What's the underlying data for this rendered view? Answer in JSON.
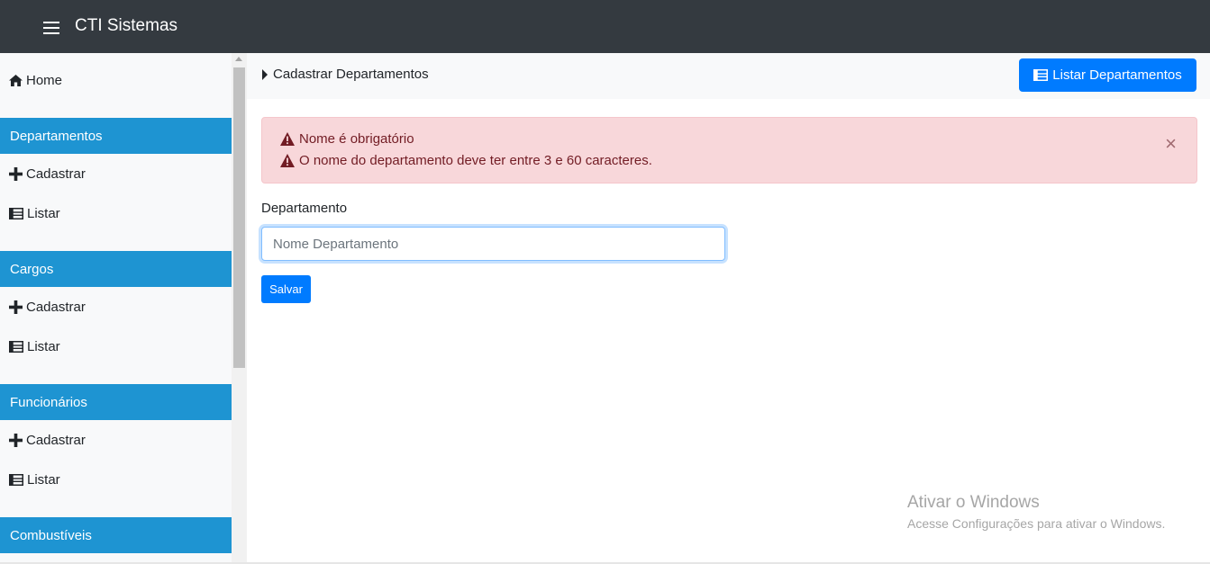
{
  "navbar": {
    "brand": "CTI Sistemas"
  },
  "sidebar": {
    "home_label": "Home",
    "sections": [
      {
        "title": "Departamentos",
        "items": [
          "Cadastrar",
          "Listar"
        ]
      },
      {
        "title": "Cargos",
        "items": [
          "Cadastrar",
          "Listar"
        ]
      },
      {
        "title": "Funcionários",
        "items": [
          "Cadastrar",
          "Listar"
        ]
      },
      {
        "title": "Combustíveis"
      }
    ],
    "header_color": "#1e94d2"
  },
  "header": {
    "breadcrumb": "Cadastrar Departamentos",
    "list_button": "Listar Departamentos"
  },
  "alert": {
    "messages": [
      "Nome é obrigatório",
      "O nome do departamento deve ter entre 3 e 60 caracteres."
    ],
    "close": "×"
  },
  "form": {
    "label": "Departamento",
    "value": "",
    "placeholder": "Nome Departamento",
    "save_label": "Salvar"
  },
  "watermark": {
    "title": "Ativar o Windows",
    "subtitle": "Acesse Configurações para ativar o Windows."
  },
  "colors": {
    "navbar": "#343a40",
    "primary": "#007bff",
    "alert_bg": "#f8d7da",
    "alert_text": "#721c24"
  },
  "icons": {
    "menu": "hamburger-icon",
    "home": "home-icon",
    "add": "plus-icon",
    "list": "table-list-icon",
    "breadcrumb": "caret-right-icon",
    "warning": "warning-triangle-icon",
    "close": "close-icon"
  }
}
